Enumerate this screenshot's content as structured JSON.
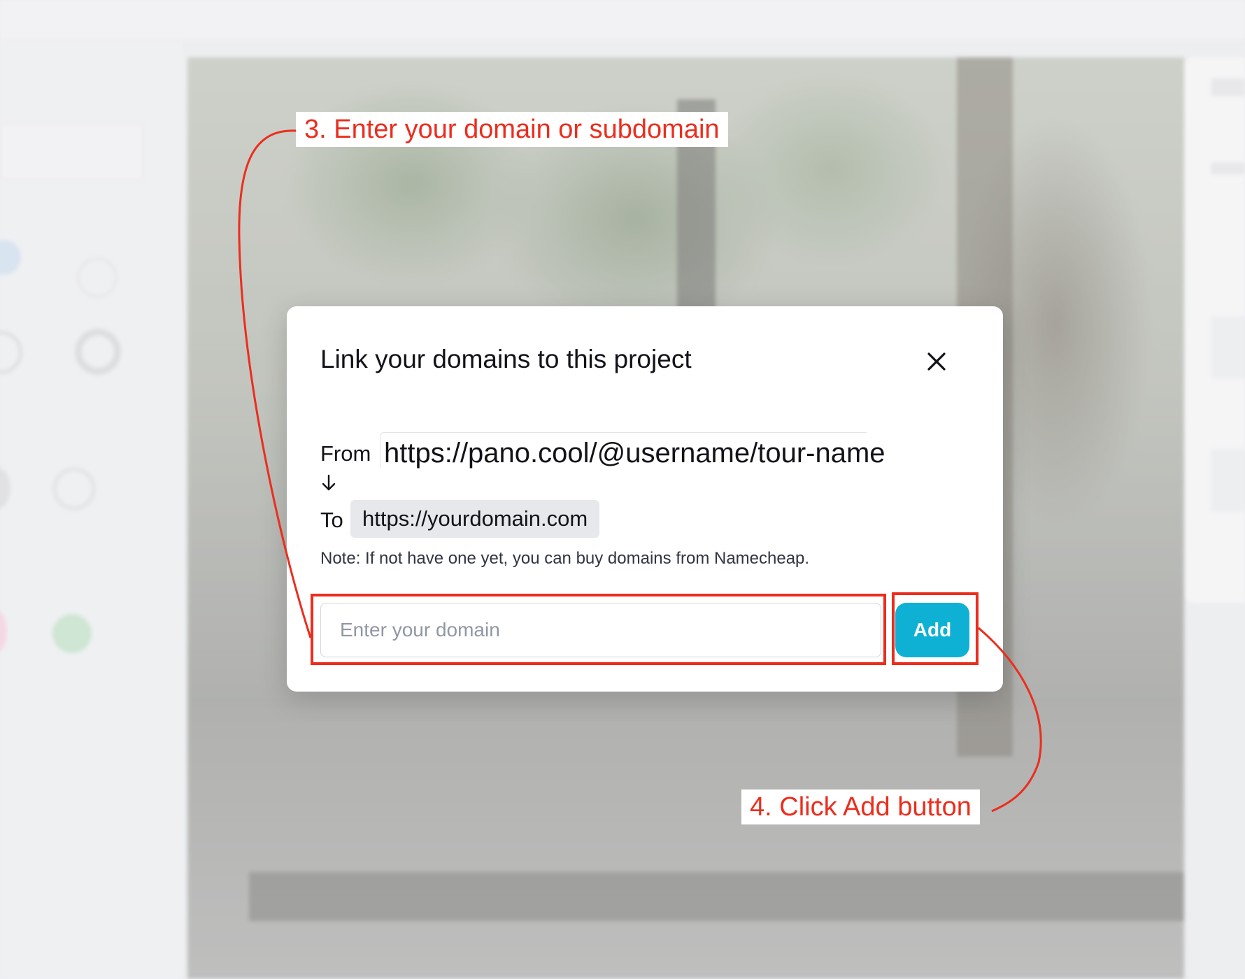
{
  "modal": {
    "title": "Link your domains to this project",
    "from_label": "From",
    "from_url": "https://pano.cool/@username/tour-name",
    "to_label": "To",
    "to_url": "https://yourdomain.com",
    "note": "Note: If not have one yet, you can buy domains from Namecheap.",
    "domain_input": {
      "value": "",
      "placeholder": "Enter your domain"
    },
    "add_label": "Add",
    "close_icon": "close-icon",
    "arrow_icon": "arrow-down-icon"
  },
  "annotations": {
    "step3": "3. Enter your domain or subdomain",
    "step4": "4. Click Add button",
    "color": "#ec2d1d"
  },
  "colors": {
    "accent": "#0eb1d4",
    "modal_bg": "#ffffff",
    "chip_bg": "#e7e8eb"
  }
}
